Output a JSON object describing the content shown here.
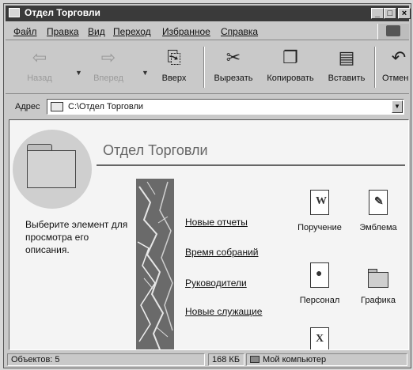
{
  "window": {
    "title": "Отдел Торговли",
    "controls": [
      "_",
      "□",
      "×"
    ]
  },
  "menu": [
    "Файл",
    "Правка",
    "Вид",
    "Переход",
    "Избранное",
    "Справка"
  ],
  "toolbar": {
    "back": "Назад",
    "forward": "Вперед",
    "up": "Вверх",
    "cut": "Вырезать",
    "copy": "Копировать",
    "paste": "Вставить",
    "undo": "Отмен"
  },
  "address": {
    "label": "Адрес",
    "value": "C:\\Отдел Торговли"
  },
  "content": {
    "folder_title": "Отдел Торговли",
    "description": "Выберите элемент для просмотра его описания.",
    "links": [
      "Новые отчеты",
      "Время собраний",
      "Руководители",
      "Новые служащие"
    ],
    "files": [
      {
        "label": "Поручение",
        "icon": "word-doc-icon",
        "glyph": "W"
      },
      {
        "label": "Эмблема",
        "icon": "image-doc-icon",
        "glyph": "✎"
      },
      {
        "label": "Персонал",
        "icon": "document-icon",
        "glyph": "●"
      },
      {
        "label": "Графика",
        "icon": "folder-icon",
        "glyph": ""
      },
      {
        "label": "",
        "icon": "excel-doc-icon",
        "glyph": "X"
      }
    ]
  },
  "status": {
    "objects": "Объектов: 5",
    "size": "168 КБ",
    "location": "Мой компьютер"
  }
}
